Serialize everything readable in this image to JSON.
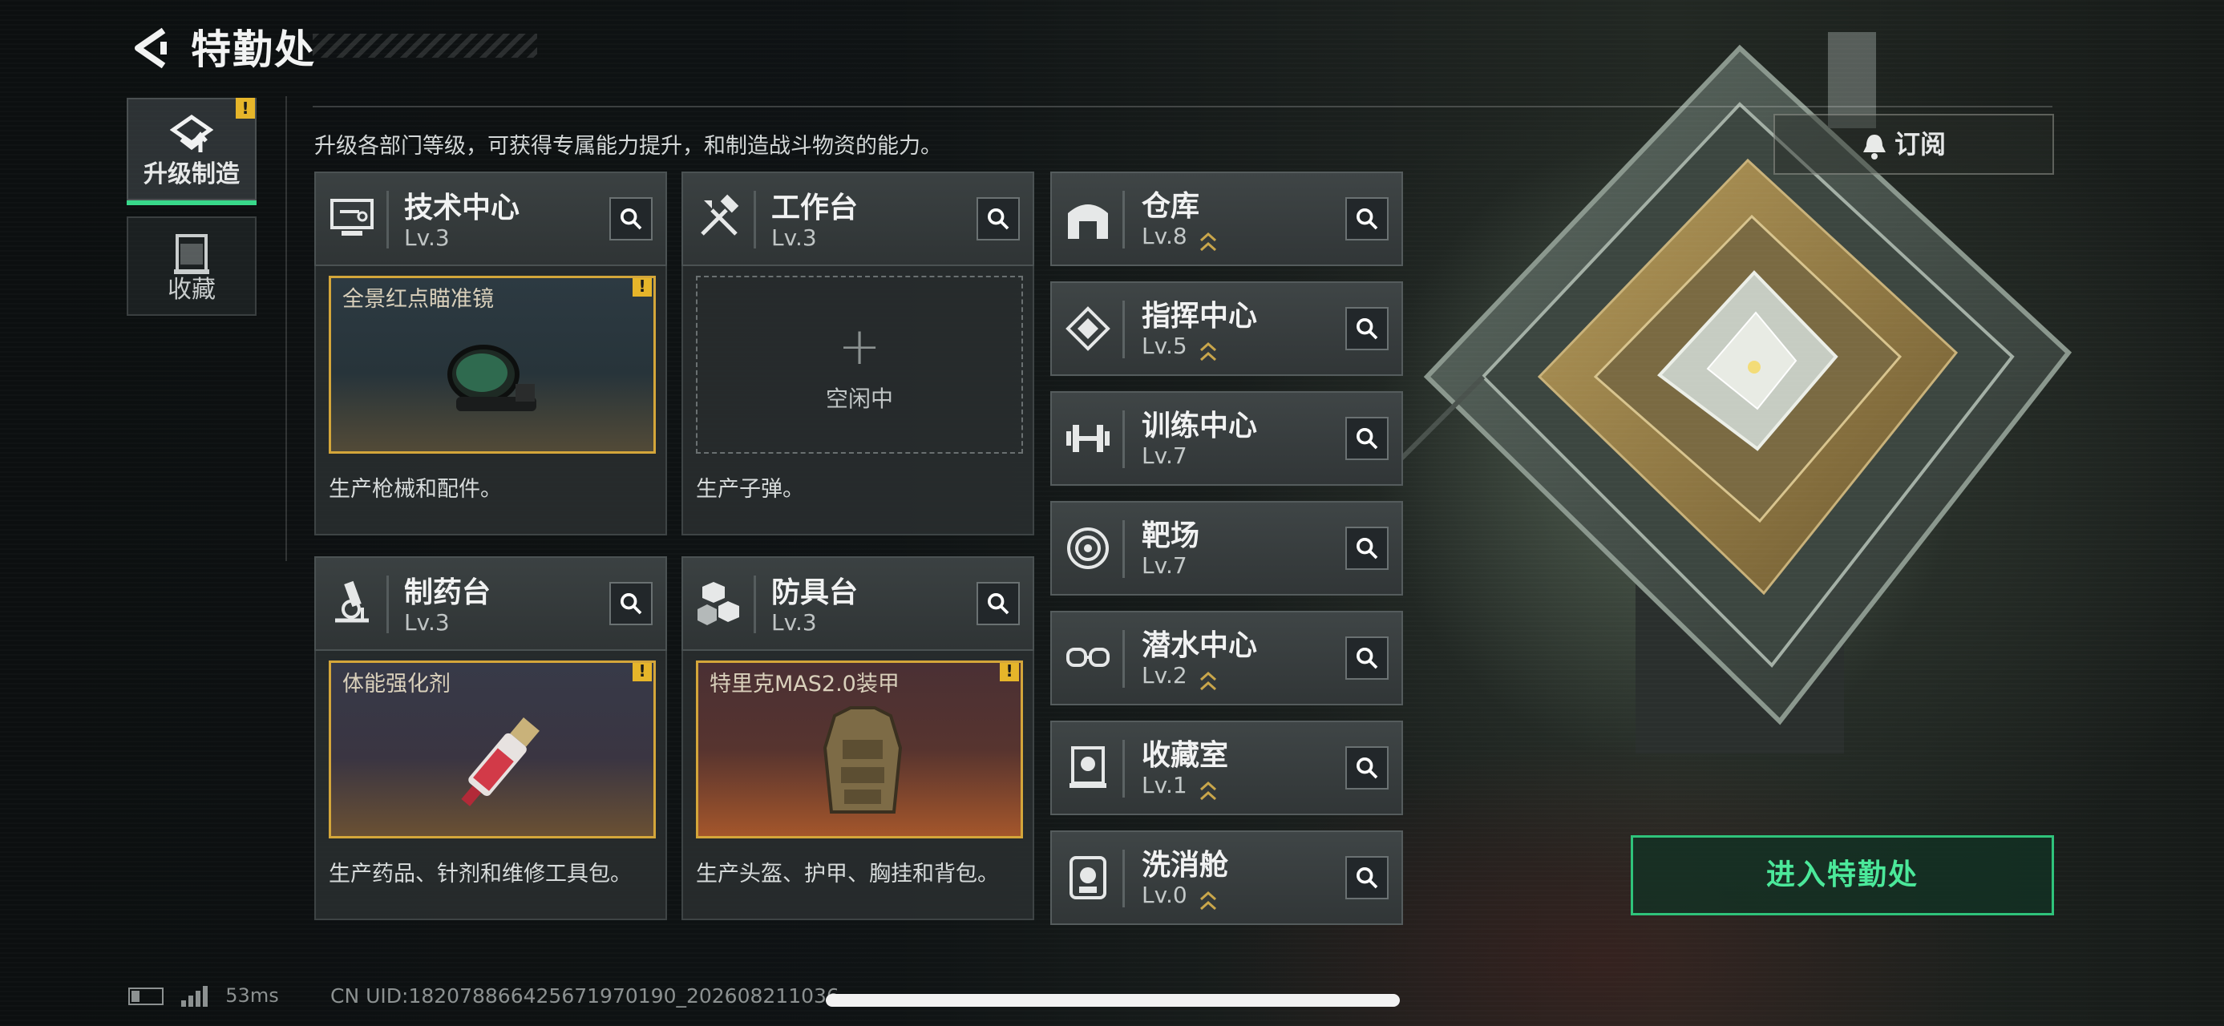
{
  "header": {
    "title": "特勤处"
  },
  "tabs": [
    {
      "label": "升级制造",
      "active": true,
      "warning": "!"
    },
    {
      "label": "收藏",
      "active": false
    }
  ],
  "description": "升级各部门等级，可获得专属能力提升，和制造战斗物资的能力。",
  "subscribe_label": "订阅",
  "cards": [
    {
      "name": "技术中心",
      "level": "Lv.3",
      "producing": "全景红点瞄准镜",
      "warning": "!",
      "desc": "生产枪械和配件。",
      "icon": "monitor-icon"
    },
    {
      "name": "工作台",
      "level": "Lv.3",
      "empty_label": "空闲中",
      "plus": "+",
      "desc": "生产子弹。",
      "icon": "tools-icon"
    },
    {
      "name": "制药台",
      "level": "Lv.3",
      "producing": "体能强化剂",
      "warning": "!",
      "desc": "生产药品、针剂和维修工具包。",
      "icon": "microscope-icon"
    },
    {
      "name": "防具台",
      "level": "Lv.3",
      "producing": "特里克MAS2.0装甲",
      "warning": "!",
      "desc": "生产头盔、护甲、胸挂和背包。",
      "icon": "cubes-icon"
    }
  ],
  "rooms": [
    {
      "name": "仓库",
      "level": "Lv.8",
      "icon": "warehouse-icon"
    },
    {
      "name": "指挥中心",
      "level": "Lv.5",
      "icon": "command-icon"
    },
    {
      "name": "训练中心",
      "level": "Lv.7",
      "icon": "dumbbell-icon"
    },
    {
      "name": "靶场",
      "level": "Lv.7",
      "icon": "target-icon"
    },
    {
      "name": "潜水中心",
      "level": "Lv.2",
      "icon": "goggles-icon"
    },
    {
      "name": "收藏室",
      "level": "Lv.1",
      "icon": "trophy-icon"
    },
    {
      "name": "洗消舱",
      "level": "Lv.0",
      "icon": "decon-icon"
    }
  ],
  "enter_button": "进入特勤处",
  "status": {
    "ping": "53ms",
    "uid": "CN UID:1820788664256719701​90_202608211036"
  },
  "colors": {
    "accent": "#38d88a",
    "warning": "#e6b52a",
    "frame": "#d4a63a"
  }
}
